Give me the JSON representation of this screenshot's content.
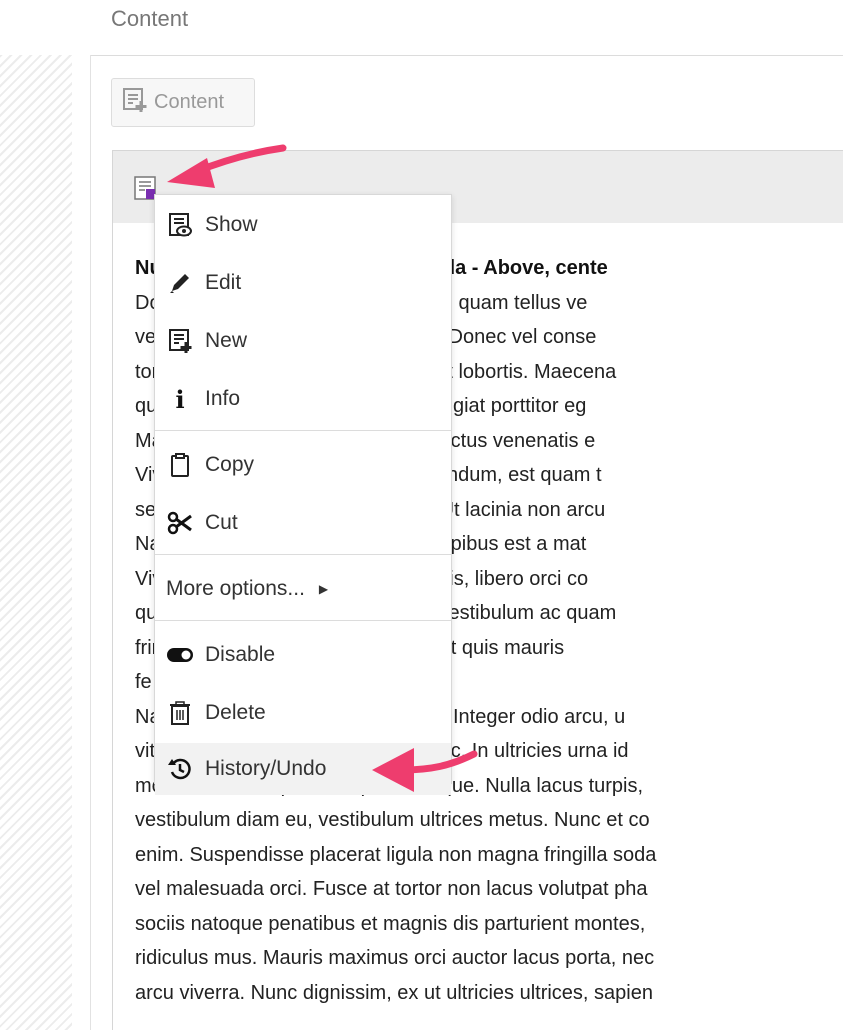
{
  "page": {
    "title": "Content"
  },
  "toolbar": {
    "content_button_label": "Content"
  },
  "menu": {
    "show": "Show",
    "edit": "Edit",
    "new": "New",
    "info": "Info",
    "copy": "Copy",
    "cut": "Cut",
    "more": "More options...",
    "disable": "Disable",
    "delete": "Delete",
    "history": "History/Undo"
  },
  "body_lines": [
    "Nulla facilisi. Nam posuere gravida - Above, cente",
    "Donec porttitor. Porttitor vestibulum, quam tellus ve",
    "vel. Donec vel nunc nunc vel justo. Donec vel conse",
    "tortor. Duis a massa massa sit amet lobortis. Maecena",
    "quis ante. Nunc libero vitae nibh feugiat porttitor eg",
    "Mauris ornare orci orci, a ultricies lectus venenatis e",
    "Vivamus rhoncus, id id tempor bibendum, est quam t",
    "sed tempus lectus lectus a lectus. Ut lacinia non arcu",
    "Nam viverra nisi. Nec sollicitudin dapibus est a mat",
    "Vivamus semper. Sed aliquet lobortis, libero orci co",
    "quis. Nam tincidunt. Nam ac erat. Vestibulum ac quam",
    "fringilla. Morbi est augue, consequat quis mauris",
    "fe",
    "Nam eget gravida posuere gravida. Integer odio arcu, u",
    "vitae ipsum, a imperdiet viverra nunc. In ultricies urna id",
    "molestie, nec dapibus mi pellentesque. Nulla lacus turpis,",
    "vestibulum diam eu, vestibulum ultrices metus. Nunc et co",
    "enim. Suspendisse placerat ligula non magna fringilla soda",
    "vel malesuada orci. Fusce at tortor non lacus volutpat pha",
    "sociis natoque penatibus et magnis dis parturient montes,",
    "ridiculus mus. Mauris maximus orci auctor lacus porta, nec",
    "arcu viverra. Nunc dignissim, ex ut ultricies ultrices, sapien"
  ],
  "colors": {
    "arrow": "#ee3d6e",
    "accent_icon": "#7a2fb0"
  }
}
